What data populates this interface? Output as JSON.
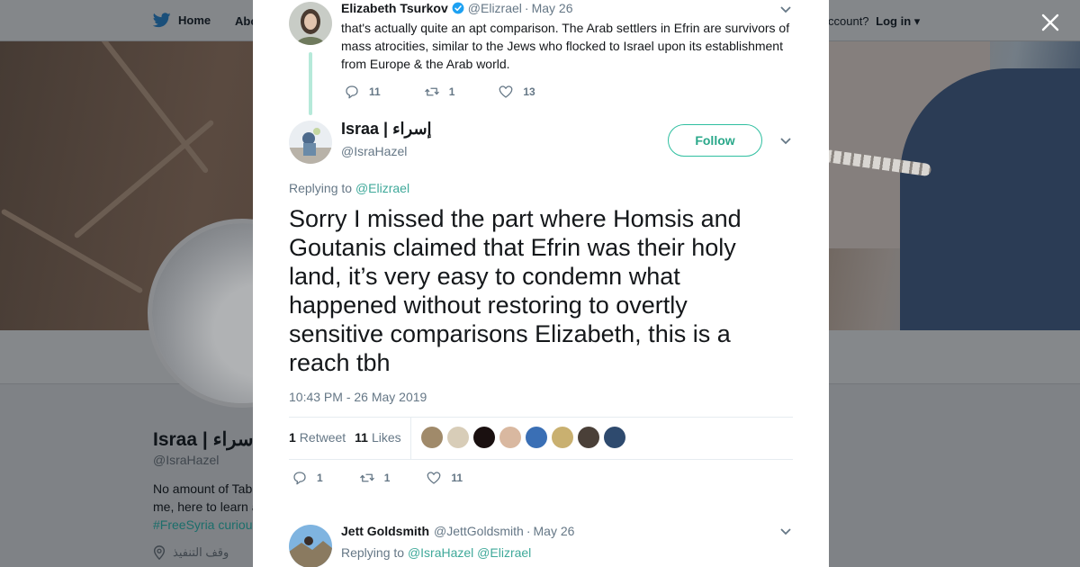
{
  "background": {
    "nav": {
      "home_label": "Home",
      "about_label": "Abo",
      "account_prompt": "ccount?",
      "login_label": "Log in"
    },
    "profile": {
      "name": "Israa | إسراء",
      "handle": "@IsraHazel",
      "bio_line1": "No amount of Tab",
      "bio_line2": "me, here to learn a",
      "bio_line3": "#FreeSyria curiou",
      "location": "وقف التنفيذ"
    }
  },
  "parent_tweet": {
    "author_name": "Elizabeth Tsurkov",
    "author_handle": "@Elizrael",
    "date": "May 26",
    "text": "that's actually quite an apt comparison. The Arab settlers in Efrin are survivors of mass atrocities, similar to the Jews who flocked to Israel upon its establishment from Europe & the Arab world.",
    "replies": "11",
    "retweets": "1",
    "likes": "13"
  },
  "tweet": {
    "author_name": "Israa | إسراء",
    "author_handle": "@IsraHazel",
    "follow_label": "Follow",
    "replying_prefix": "Replying to",
    "replying_to": "@Elizrael",
    "text": "Sorry I missed the part where Homsis and Goutanis claimed that Efrin was their holy land, it’s very easy to condemn what happened without restoring to overtly sensitive comparisons Elizabeth, this is a reach tbh",
    "timestamp": "10:43 PM - 26 May 2019",
    "retweet_count": "1",
    "retweet_label": "Retweet",
    "likes_count": "11",
    "likes_label": "Likes",
    "likers": [
      "#a08a6a",
      "#d8cdb8",
      "#1a1010",
      "#d9b8a0",
      "#3a6fb5",
      "#c9b070",
      "#4a4038",
      "#2e4a6e"
    ],
    "actions": {
      "replies": "1",
      "retweets": "1",
      "likes": "11"
    }
  },
  "reply": {
    "author_name": "Jett Goldsmith",
    "author_handle": "@JettGoldsmith",
    "date": "May 26",
    "replying_prefix": "Replying to",
    "replying_to_1": "@IsraHazel",
    "replying_to_2": "@Elizrael"
  },
  "colors": {
    "accent": "#2aa88a",
    "link": "#3fa99a",
    "thread_line": "#b6e9d9",
    "verified": "#1da1f2"
  }
}
